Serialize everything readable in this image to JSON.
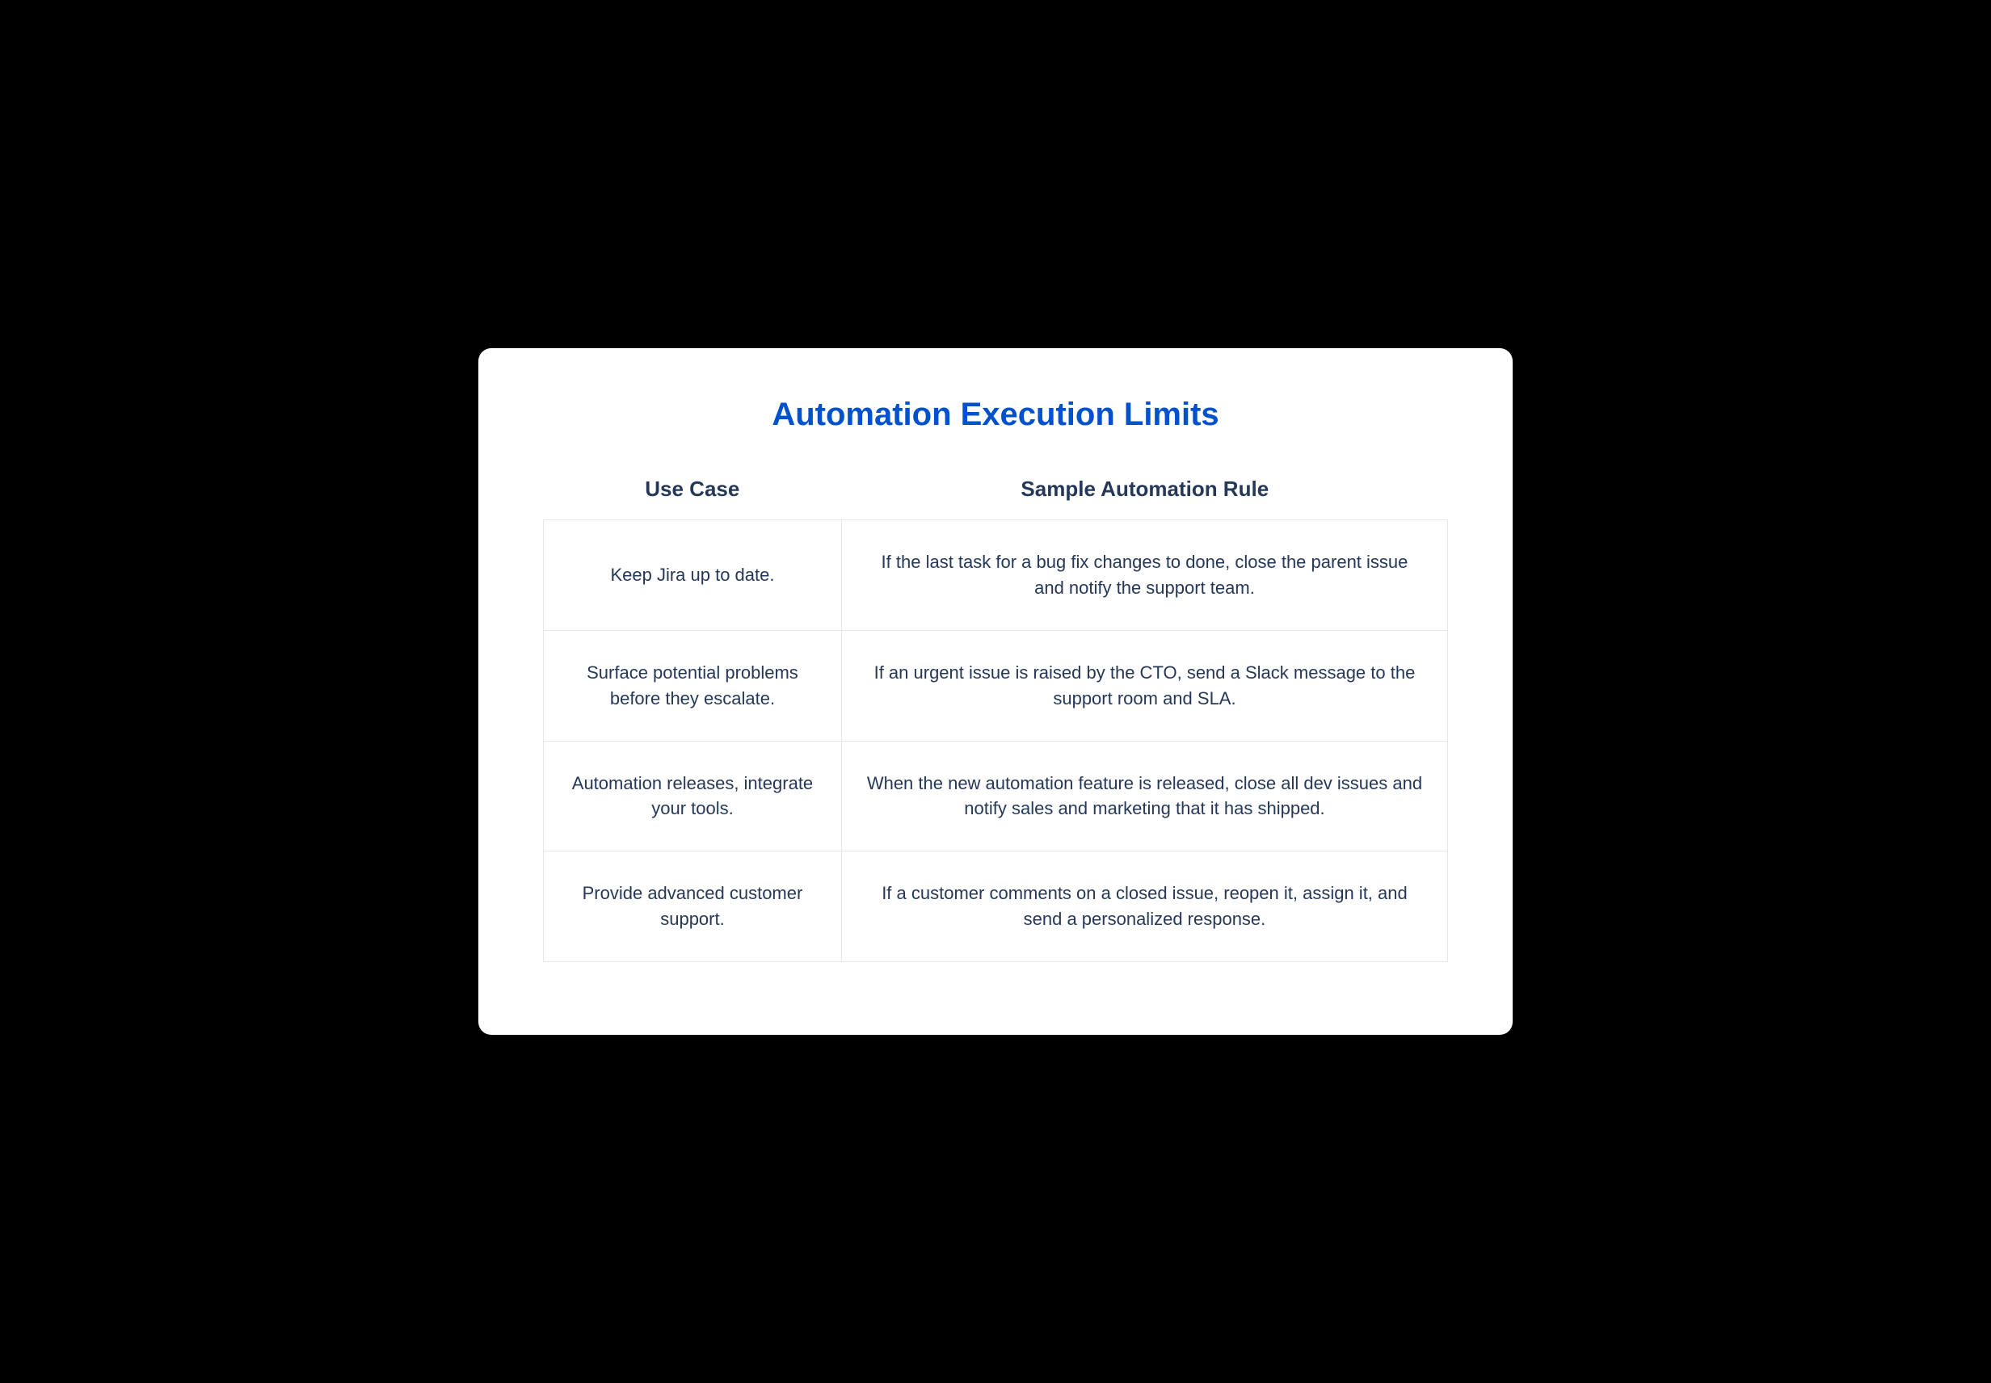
{
  "title": "Automation Execution Limits",
  "columns": {
    "usecase": "Use Case",
    "rule": "Sample Automation Rule"
  },
  "rows": [
    {
      "usecase": "Keep Jira up to date.",
      "rule": "If the last task for a bug fix changes to done, close the parent issue and notify the support team."
    },
    {
      "usecase": "Surface potential problems before they escalate.",
      "rule": "If an urgent issue is raised by the CTO, send a Slack message to the support room and SLA."
    },
    {
      "usecase": "Automation releases, integrate your tools.",
      "rule": "When the new automation feature is released, close all dev issues and notify sales and marketing that it has shipped."
    },
    {
      "usecase": "Provide advanced customer support.",
      "rule": "If a customer comments on a closed issue, reopen it, assign it, and send a personalized response."
    }
  ]
}
